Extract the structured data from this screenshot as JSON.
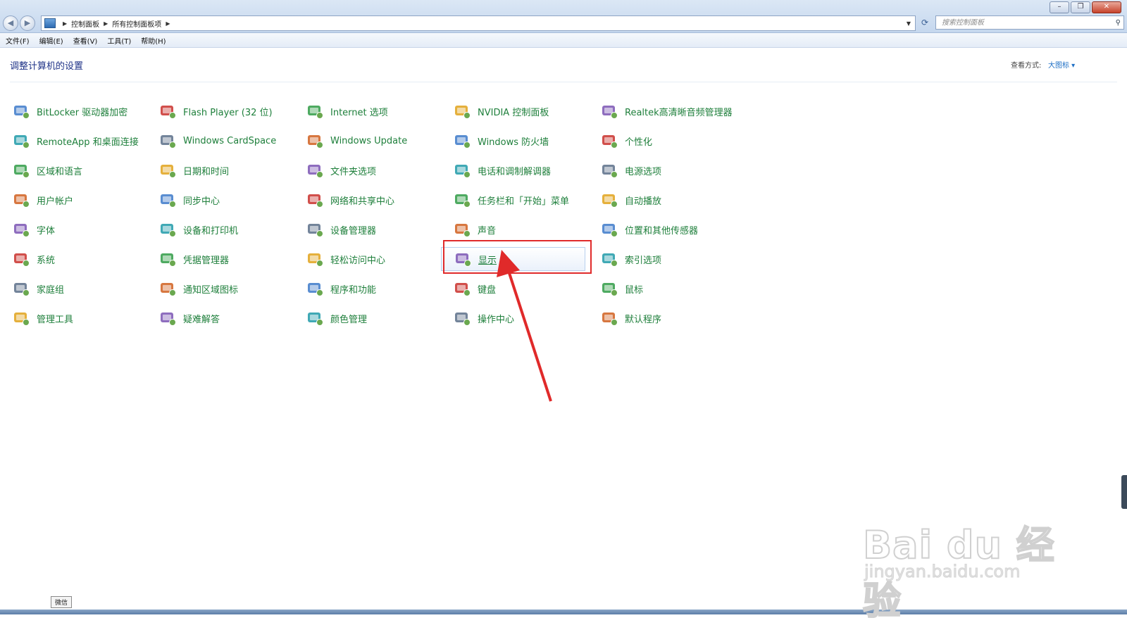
{
  "window": {
    "controls": [
      "minimize",
      "restore",
      "close"
    ],
    "breadcrumb": [
      "控制面板",
      "所有控制面板项"
    ],
    "search_placeholder": "搜索控制面板"
  },
  "menu": [
    "文件(F)",
    "编辑(E)",
    "查看(V)",
    "工具(T)",
    "帮助(H)"
  ],
  "header": {
    "title": "调整计算机的设置",
    "view_by_label": "查看方式:",
    "view_by_value": "大图标 ▾"
  },
  "items": [
    {
      "label": "BitLocker 驱动器加密",
      "icon": "bitlocker-key-icon"
    },
    {
      "label": "Flash Player (32 位)",
      "icon": "flash-player-icon"
    },
    {
      "label": "Internet 选项",
      "icon": "internet-options-icon"
    },
    {
      "label": "NVIDIA 控制面板",
      "icon": "nvidia-icon"
    },
    {
      "label": "Realtek高清晰音频管理器",
      "icon": "realtek-audio-icon"
    },
    {
      "label": "RemoteApp 和桌面连接",
      "icon": "remoteapp-icon"
    },
    {
      "label": "Windows CardSpace",
      "icon": "cardspace-icon"
    },
    {
      "label": "Windows Update",
      "icon": "windows-update-icon"
    },
    {
      "label": "Windows 防火墙",
      "icon": "firewall-icon"
    },
    {
      "label": "个性化",
      "icon": "personalization-icon"
    },
    {
      "label": "区域和语言",
      "icon": "region-language-icon"
    },
    {
      "label": "日期和时间",
      "icon": "date-time-icon"
    },
    {
      "label": "文件夹选项",
      "icon": "folder-options-icon"
    },
    {
      "label": "电话和调制解调器",
      "icon": "phone-modem-icon"
    },
    {
      "label": "电源选项",
      "icon": "power-options-icon"
    },
    {
      "label": "用户帐户",
      "icon": "user-accounts-icon"
    },
    {
      "label": "同步中心",
      "icon": "sync-center-icon"
    },
    {
      "label": "网络和共享中心",
      "icon": "network-sharing-icon"
    },
    {
      "label": "任务栏和「开始」菜单",
      "icon": "taskbar-start-icon"
    },
    {
      "label": "自动播放",
      "icon": "autoplay-icon"
    },
    {
      "label": "字体",
      "icon": "fonts-icon"
    },
    {
      "label": "设备和打印机",
      "icon": "devices-printers-icon"
    },
    {
      "label": "设备管理器",
      "icon": "device-manager-icon"
    },
    {
      "label": "声音",
      "icon": "sound-icon"
    },
    {
      "label": "位置和其他传感器",
      "icon": "location-sensors-icon"
    },
    {
      "label": "系统",
      "icon": "system-icon"
    },
    {
      "label": "凭据管理器",
      "icon": "credential-manager-icon"
    },
    {
      "label": "轻松访问中心",
      "icon": "ease-of-access-icon"
    },
    {
      "label": "显示",
      "icon": "display-icon"
    },
    {
      "label": "索引选项",
      "icon": "indexing-options-icon"
    },
    {
      "label": "家庭组",
      "icon": "homegroup-icon"
    },
    {
      "label": "通知区域图标",
      "icon": "notification-area-icon"
    },
    {
      "label": "程序和功能",
      "icon": "programs-features-icon"
    },
    {
      "label": "键盘",
      "icon": "keyboard-icon"
    },
    {
      "label": "鼠标",
      "icon": "mouse-icon"
    },
    {
      "label": "管理工具",
      "icon": "admin-tools-icon"
    },
    {
      "label": "疑难解答",
      "icon": "troubleshooting-icon"
    },
    {
      "label": "颜色管理",
      "icon": "color-management-icon"
    },
    {
      "label": "操作中心",
      "icon": "action-center-icon"
    },
    {
      "label": "默认程序",
      "icon": "default-programs-icon"
    }
  ],
  "tooltip": "微信",
  "watermark": {
    "brand": "Bai du 经验",
    "url": "jingyan.baidu.com"
  },
  "colors": {
    "link_green": "#1e7f3b",
    "title_blue": "#1e3287",
    "highlight_red": "#e02a2a"
  }
}
